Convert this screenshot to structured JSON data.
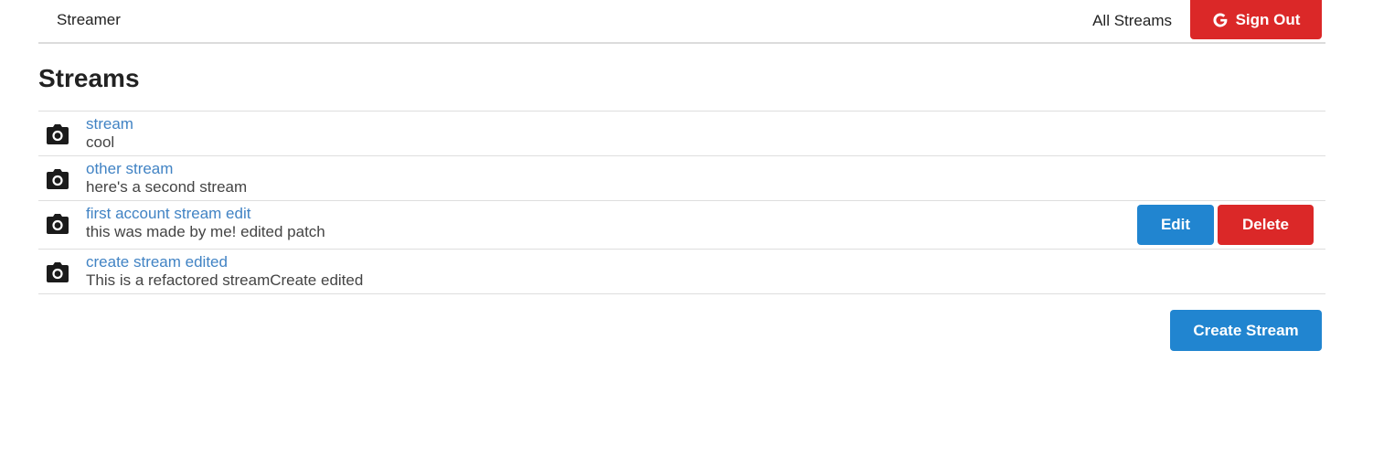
{
  "header": {
    "brand": "Streamer",
    "all_streams_link": "All Streams",
    "sign_out_label": "Sign Out"
  },
  "page": {
    "title": "Streams"
  },
  "streams": [
    {
      "title": "stream",
      "description": "cool"
    },
    {
      "title": "other stream",
      "description": "here's a second stream"
    },
    {
      "title": "first account stream edit",
      "description": "this was made by me! edited patch",
      "edit_label": "Edit",
      "delete_label": "Delete"
    },
    {
      "title": "create stream edited",
      "description": "This is a refactored streamCreate edited"
    }
  ],
  "create_button_label": "Create Stream",
  "colors": {
    "primary": "#2185d0",
    "danger": "#db2828",
    "link": "#4183c4"
  },
  "icons": {
    "stream_item": "camera-icon",
    "sign_out": "google-icon"
  }
}
